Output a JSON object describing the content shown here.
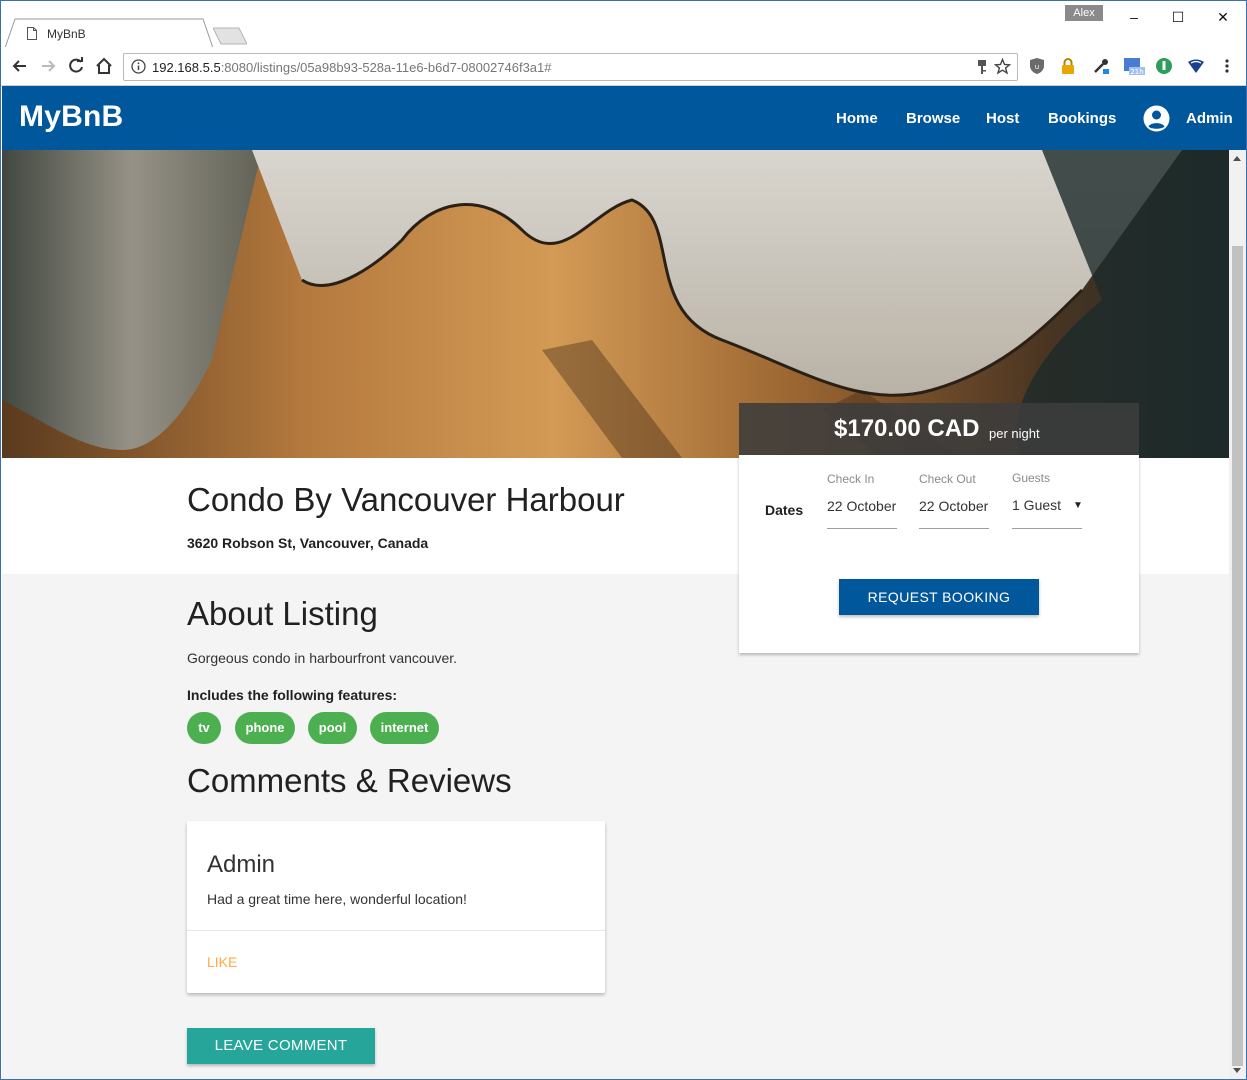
{
  "browser": {
    "tab_title": "MyBnB",
    "user_chip": "Alex",
    "window_controls": {
      "minimize": "–",
      "maximize": "☐",
      "close": "✕"
    },
    "url_host": "192.168.5.5",
    "url_rest": ":8080/listings/05a98b93-528a-11e6-b6d7-08002746f3a1#",
    "extension_badge": "21h"
  },
  "app": {
    "brand": "MyBnB",
    "nav": [
      "Home",
      "Browse",
      "Host",
      "Bookings"
    ],
    "account_label": "Admin"
  },
  "listing": {
    "title": "Condo By Vancouver Harbour",
    "address": "3620 Robson St, Vancouver, Canada",
    "about_heading": "About Listing",
    "description": "Gorgeous condo in harbourfront vancouver.",
    "features_heading": "Includes the following features:",
    "features": [
      "tv",
      "phone",
      "pool",
      "internet"
    ]
  },
  "comments": {
    "heading": "Comments & Reviews",
    "items": [
      {
        "author": "Admin",
        "text": "Had a great time here, wonderful location!",
        "action": "LIKE"
      }
    ],
    "leave_button": "LEAVE COMMENT"
  },
  "booking": {
    "price": "$170.00 CAD",
    "price_suffix": "per night",
    "dates_label": "Dates",
    "check_in_label": "Check In",
    "check_in_value": "22 October",
    "check_out_label": "Check Out",
    "check_out_value": "22 October",
    "guests_label": "Guests",
    "guests_value": "1 Guest",
    "request_button": "REQUEST BOOKING"
  },
  "colors": {
    "appbar": "#01579b",
    "chip": "#4caf50",
    "leave_button": "#26a69a",
    "like": "#ffab40"
  }
}
